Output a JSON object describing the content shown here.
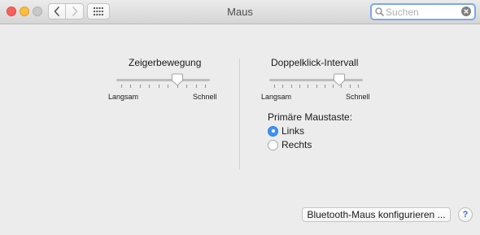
{
  "window": {
    "title": "Maus"
  },
  "toolbar": {
    "back_icon": "chevron-left-icon",
    "forward_icon": "chevron-right-icon",
    "show_all_icon": "grid-icon"
  },
  "search": {
    "placeholder": "Suchen",
    "value": ""
  },
  "pointer_speed": {
    "label": "Zeigerbewegung",
    "min_label": "Langsam",
    "max_label": "Schnell",
    "tick_count": 10,
    "value": 0.67
  },
  "double_click": {
    "label": "Doppelklick-Intervall",
    "min_label": "Langsam",
    "max_label": "Schnell",
    "tick_count": 11,
    "value": 0.78
  },
  "primary_button": {
    "label": "Primäre Maustaste:",
    "options": [
      {
        "label": "Links",
        "selected": true
      },
      {
        "label": "Rechts",
        "selected": false
      }
    ]
  },
  "footer": {
    "bluetooth_button": "Bluetooth-Maus konfigurieren ...",
    "help_button": "?"
  },
  "colors": {
    "accent": "#3d93f5",
    "search_focus": "#79a7ee"
  }
}
